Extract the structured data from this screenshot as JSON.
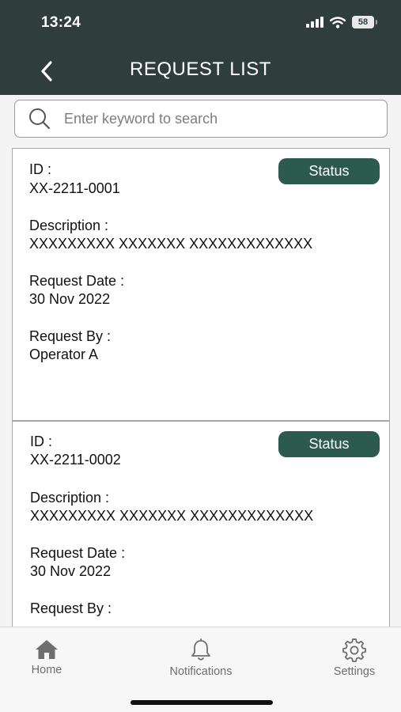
{
  "status_bar": {
    "time": "13:24",
    "battery": "58"
  },
  "header": {
    "title": "REQUEST LIST"
  },
  "search": {
    "placeholder": "Enter keyword to search"
  },
  "requests": [
    {
      "id_label": "ID :",
      "id": "XX-2211-0001",
      "status": "Status",
      "description_label": "Description :",
      "description": "XXXXXXXXX XXXXXXX XXXXXXXXXXXXX",
      "date_label": "Request Date :",
      "date": "30 Nov 2022",
      "by_label": "Request By :",
      "by": "Operator A"
    },
    {
      "id_label": "ID :",
      "id": "XX-2211-0002",
      "status": "Status",
      "description_label": "Description :",
      "description": "XXXXXXXXX XXXXXXX XXXXXXXXXXXXX",
      "date_label": "Request Date :",
      "date": "30 Nov 2022",
      "by_label": "Request By :",
      "by": ""
    }
  ],
  "tabbar": {
    "items": [
      {
        "label": "Home",
        "icon": "home-icon"
      },
      {
        "label": "Notifications",
        "icon": "bell-icon"
      },
      {
        "label": "Settings",
        "icon": "gear-icon"
      }
    ]
  },
  "colors": {
    "header": "#2f3e3d",
    "status_badge": "#2c5a4f",
    "accent_text": "#ffffff"
  }
}
